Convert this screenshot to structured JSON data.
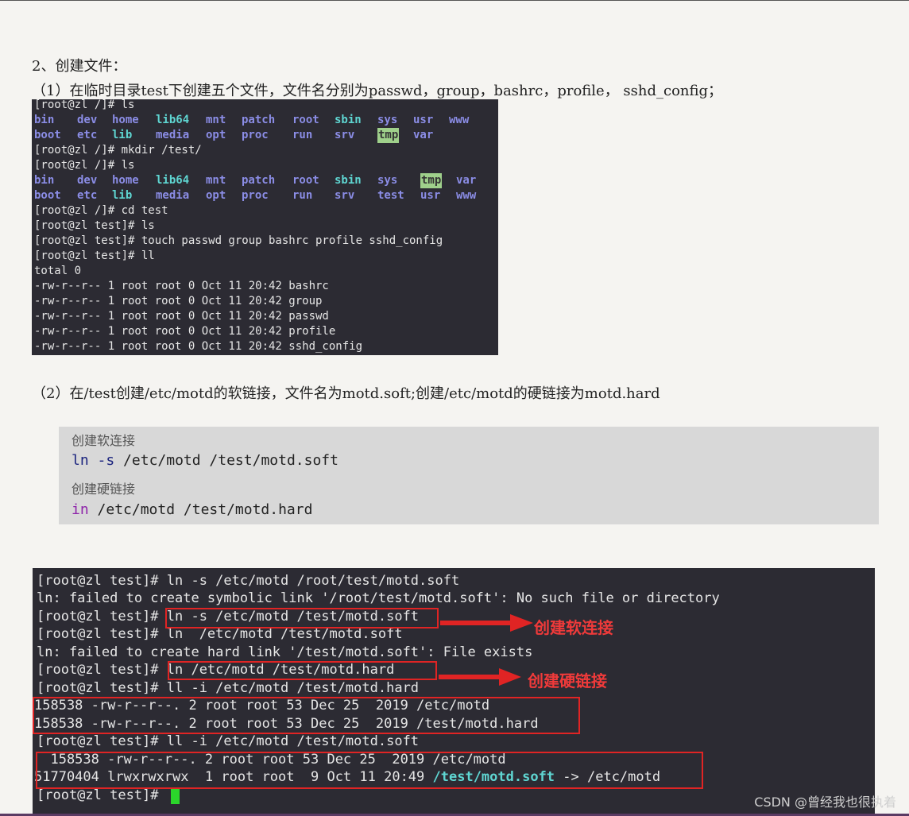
{
  "heading": "2、创建文件：",
  "para1": "（1）在临时目录test下创建五个文件，文件名分别为passwd，group，bashrc，profile， sshd_config；",
  "para2": "（2）在/test创建/etc/motd的软链接，文件名为motd.soft;创建/etc/motd的硬链接为motd.hard",
  "terminal1": {
    "prompt_ls_1": "[root@zl /]# ls",
    "ls1_row1": [
      [
        "bin",
        "dir"
      ],
      [
        "dev",
        "dir"
      ],
      [
        "home",
        "dir"
      ],
      [
        "lib64",
        "lnk"
      ],
      [
        "mnt",
        "dir"
      ],
      [
        "patch",
        "dir"
      ],
      [
        "root",
        "dir"
      ],
      [
        "sbin",
        "lnk"
      ],
      [
        "sys",
        "dir"
      ],
      [
        "usr",
        "dir"
      ],
      [
        "www",
        "dir"
      ]
    ],
    "ls1_row2": [
      [
        "boot",
        "dir"
      ],
      [
        "etc",
        "dir"
      ],
      [
        "lib",
        "lnk"
      ],
      [
        "media",
        "dir"
      ],
      [
        "opt",
        "dir"
      ],
      [
        "proc",
        "dir"
      ],
      [
        "run",
        "dir"
      ],
      [
        "srv",
        "dir"
      ],
      [
        "tmp",
        "tmp"
      ],
      [
        "var",
        "dir"
      ]
    ],
    "mkdir": "[root@zl /]# mkdir /test/",
    "prompt_ls_2": "[root@zl /]# ls",
    "ls2_row1": [
      [
        "bin",
        "dir"
      ],
      [
        "dev",
        "dir"
      ],
      [
        "home",
        "dir"
      ],
      [
        "lib64",
        "lnk"
      ],
      [
        "mnt",
        "dir"
      ],
      [
        "patch",
        "dir"
      ],
      [
        "root",
        "dir"
      ],
      [
        "sbin",
        "lnk"
      ],
      [
        "sys",
        "dir"
      ],
      [
        "tmp",
        "tmp"
      ],
      [
        "var",
        "dir"
      ]
    ],
    "ls2_row2": [
      [
        "boot",
        "dir"
      ],
      [
        "etc",
        "dir"
      ],
      [
        "lib",
        "lnk"
      ],
      [
        "media",
        "dir"
      ],
      [
        "opt",
        "dir"
      ],
      [
        "proc",
        "dir"
      ],
      [
        "run",
        "dir"
      ],
      [
        "srv",
        "dir"
      ],
      [
        "test",
        "dir"
      ],
      [
        "usr",
        "dir"
      ],
      [
        "www",
        "dir"
      ]
    ],
    "cd": "[root@zl /]# cd test",
    "ls3": "[root@zl test]# ls",
    "touch": "[root@zl test]# touch passwd group bashrc profile sshd_config",
    "ll": "[root@zl test]# ll",
    "total": "total 0",
    "f1": "-rw-r--r-- 1 root root 0 Oct 11 20:42 bashrc",
    "f2": "-rw-r--r-- 1 root root 0 Oct 11 20:42 group",
    "f3": "-rw-r--r-- 1 root root 0 Oct 11 20:42 passwd",
    "f4": "-rw-r--r-- 1 root root 0 Oct 11 20:42 profile",
    "f5": "-rw-r--r-- 1 root root 0 Oct 11 20:42 sshd_config"
  },
  "codeblock": {
    "comment1": "创建软连接",
    "code1_kw": "ln",
    "code1_flag": "-s",
    "code1_rest": " /etc/motd /test/motd.soft",
    "comment2": "创建硬链接",
    "code2_kw": "in",
    "code2_rest": " /etc/motd /test/motd.hard"
  },
  "terminal2": {
    "l1": "[root@zl test]# ln -s /etc/motd /root/test/motd.soft",
    "l2": "ln: failed to create symbolic link '/root/test/motd.soft': No such file or directory",
    "l3": "[root@zl test]# ln -s /etc/motd /test/motd.soft",
    "l4": "[root@zl test]# ln  /etc/motd /test/motd.soft",
    "l5": "ln: failed to create hard link '/test/motd.soft': File exists",
    "l6": "[root@zl test]# ln /etc/motd /test/motd.hard",
    "l7": "[root@zl test]# ll -i /etc/motd /test/motd.hard",
    "l8": "158538 -rw-r--r--. 2 root root 53 Dec 25  2019 /etc/motd",
    "l9": "158538 -rw-r--r--. 2 root root 53 Dec 25  2019 /test/motd.hard",
    "l10": "[root@zl test]# ll -i /etc/motd /test/motd.soft",
    "l11": "  158538 -rw-r--r--. 2 root root 53 Dec 25  2019 /etc/motd",
    "l12_pre": "51770404 lrwxrwxrwx  1 root root  9 Oct 11 20:49 ",
    "l12_link": "/test/motd.soft",
    "l12_post": " -> /etc/motd",
    "l13": "[root@zl test]# ",
    "annotation_soft": "创建软连接",
    "annotation_hard": "创建硬链接",
    "annotation_color": "#e02424"
  },
  "watermark": "CSDN @曾经我也很执着"
}
